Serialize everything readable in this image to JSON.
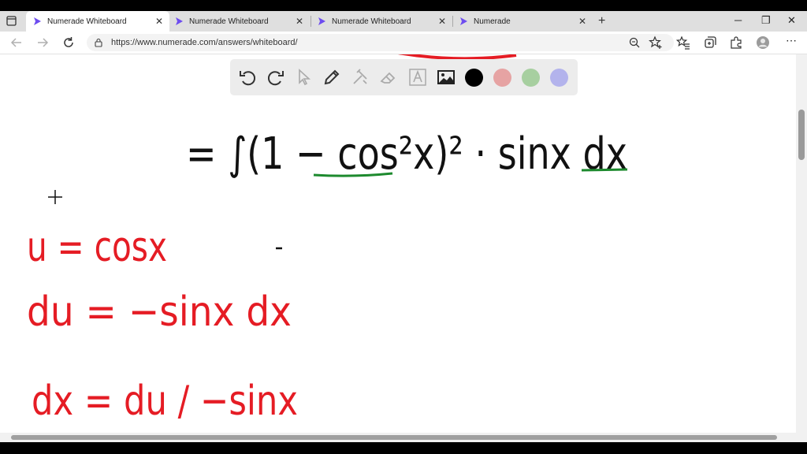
{
  "tabs": [
    {
      "label": "Numerade Whiteboard",
      "active": true
    },
    {
      "label": "Numerade Whiteboard",
      "active": false
    },
    {
      "label": "Numerade Whiteboard",
      "active": false
    },
    {
      "label": "Numerade",
      "active": false
    }
  ],
  "new_tab_label": "+",
  "address": {
    "url": "https://www.numerade.com/answers/whiteboard/"
  },
  "palette": {
    "tools": [
      "undo-icon",
      "redo-icon",
      "select-icon",
      "pen-icon",
      "tools-icon",
      "eraser-icon",
      "text-icon",
      "image-icon"
    ],
    "colors": [
      "#000000",
      "#e6a3a3",
      "#a7cfa0",
      "#b3b3ec"
    ]
  },
  "handwriting": {
    "line1": "= ∫(1 − cos²x)² · sinx dx",
    "line2": "u = cosx",
    "line3": "du = −sinx dx",
    "line4": "dx = du / −sinx"
  },
  "colors": {
    "ink_black": "#111111",
    "ink_red": "#e51c24",
    "ink_green": "#1d8a2e"
  }
}
